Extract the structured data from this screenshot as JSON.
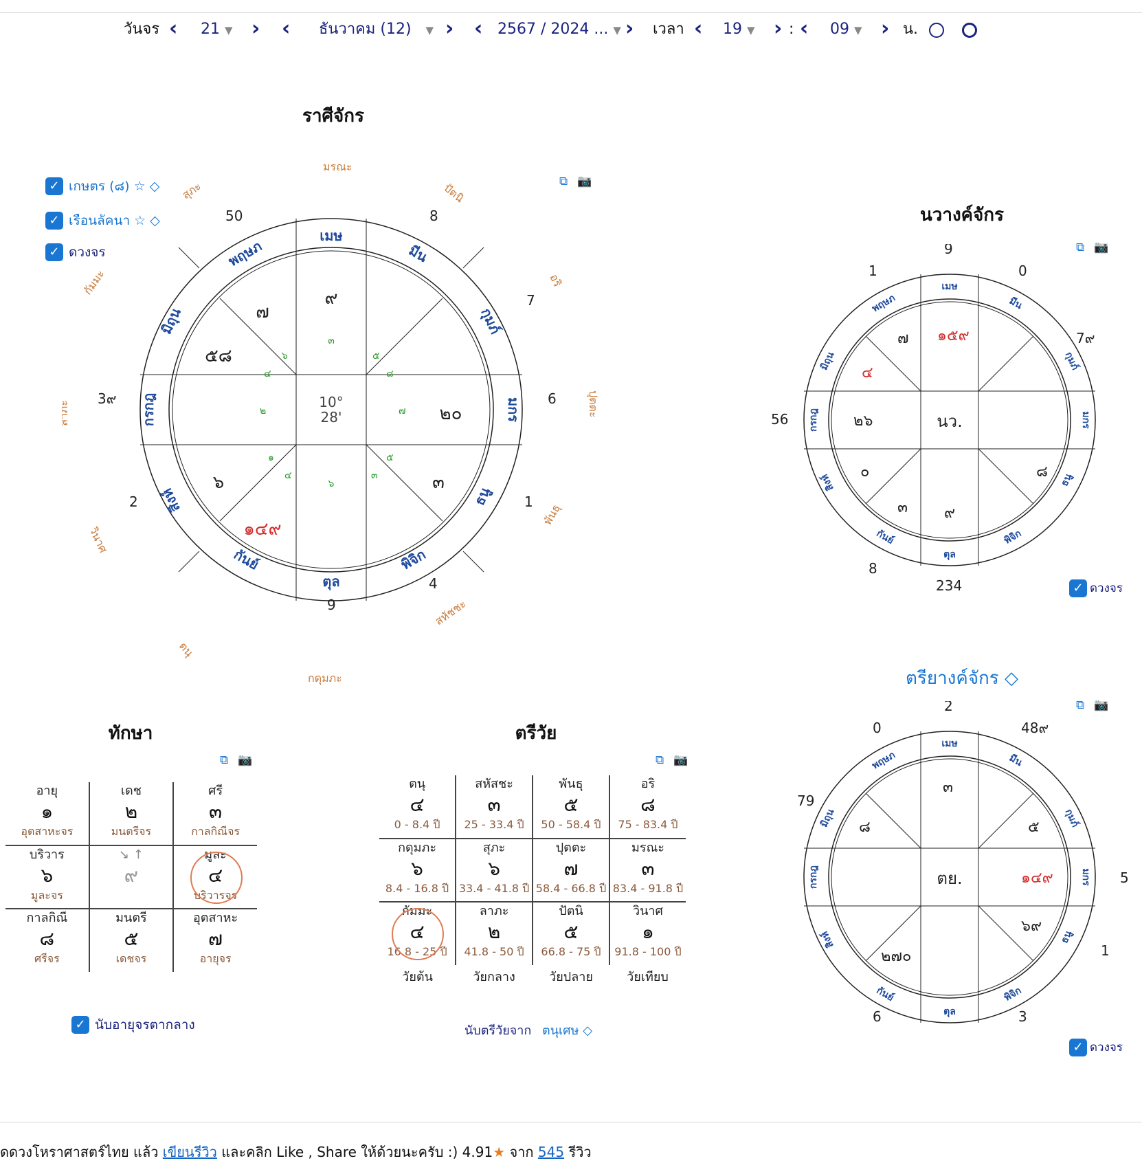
{
  "datebar": {
    "day_label": "วันจร",
    "day_value": "21",
    "month_value": "ธันวาคม (12)",
    "year_value": "2567 / 2024 ...",
    "time_label": "เวลา",
    "hour_value": "19",
    "colon": ":",
    "minute_value": "09",
    "unit": "น."
  },
  "rasi": {
    "title": "ราศีจักร",
    "checkboxes": [
      {
        "label": "เกษตร (๘) ☆ ◇",
        "checked": true
      },
      {
        "label": "เรือนลัคนา ☆ ◇",
        "checked": true
      },
      {
        "label": "ดวงจร",
        "checked": true
      }
    ],
    "center": [
      "10°",
      "28'"
    ],
    "signs": [
      "เมษ",
      "พฤษภ",
      "มิถุน",
      "กรกฎ",
      "สิงห์",
      "กันย์",
      "ตุล",
      "พิจิก",
      "ธนู",
      "มกร",
      "กุมภ์",
      "มีน"
    ],
    "outer_numbers": [
      "50",
      "8",
      "7",
      "6",
      "1",
      "4",
      "9",
      "2",
      "3๙"
    ],
    "house_names": [
      "มรณะ",
      "ปัตนิ",
      "อริ",
      "ปุตตะ",
      "พันธุ",
      "สหัชชะ",
      "กดุมภะ",
      "ตนุ",
      "วินาศ",
      "ลาภะ",
      "กัมมะ",
      "สุภะ"
    ],
    "cell_planets": [
      "๙",
      "๗",
      "๕๘",
      "๖",
      "๑๔๙",
      "๓",
      "๒๐"
    ],
    "small_numbers": [
      "๓",
      "๖",
      "๔",
      "๕",
      "๘",
      "๒",
      "๗",
      "๑",
      "๔",
      "๖",
      "๓",
      "๕"
    ]
  },
  "navang": {
    "title": "นวางค์จักร",
    "center": "นว.",
    "outer_numbers": [
      "9",
      "0",
      "7๙",
      "56",
      "234",
      "1",
      "8"
    ],
    "cell_planets": [
      "๑๕๙",
      "๗",
      "๔",
      "๒๖",
      "๐",
      "๓",
      "๙",
      "๘"
    ],
    "checkbox": "ดวงจร"
  },
  "triyang": {
    "title": "ตรียางค์จักร ◇",
    "center": "ตย.",
    "outer_numbers": [
      "2",
      "0",
      "48๙",
      "79",
      "5",
      "1",
      "3",
      "6"
    ],
    "cell_planets": [
      "๓",
      "๘",
      "๕",
      "๑๔๙",
      "๖๙",
      "๒๗๐"
    ],
    "checkbox": "ดวงจร"
  },
  "taksa": {
    "title": "ทักษา",
    "rows": [
      [
        {
          "n": "อายุ",
          "v": "๑",
          "s": "อุตสาหะจร"
        },
        {
          "n": "เดช",
          "v": "๒",
          "s": "มนตรีจร"
        },
        {
          "n": "ศรี",
          "v": "๓",
          "s": "กาลกิณีจร"
        }
      ],
      [
        {
          "n": "บริวาร",
          "v": "๖",
          "s": "มูละจร"
        },
        {
          "n": "↘ ↑",
          "v": "๙",
          "s": ""
        },
        {
          "n": "มูละ",
          "v": "๔",
          "s": "บริวารจร"
        }
      ],
      [
        {
          "n": "กาลกิณี",
          "v": "๘",
          "s": "ศรีจร"
        },
        {
          "n": "มนตรี",
          "v": "๕",
          "s": "เดชจร"
        },
        {
          "n": "อุตสาหะ",
          "v": "๗",
          "s": "อายุจร"
        }
      ]
    ],
    "checkbox": "นับอายุจรตากลาง"
  },
  "triwai": {
    "title": "ตรีวัย",
    "rows": [
      [
        {
          "n": "ตนุ",
          "v": "๔",
          "s": "0 - 8.4 ปี"
        },
        {
          "n": "สหัสชะ",
          "v": "๓",
          "s": "25 - 33.4 ปี"
        },
        {
          "n": "พันธุ",
          "v": "๕",
          "s": "50 - 58.4 ปี"
        },
        {
          "n": "อริ",
          "v": "๘",
          "s": "75 - 83.4 ปี"
        }
      ],
      [
        {
          "n": "กดุมภะ",
          "v": "๖",
          "s": "8.4 - 16.8 ปี"
        },
        {
          "n": "สุภะ",
          "v": "๖",
          "s": "33.4 - 41.8 ปี"
        },
        {
          "n": "ปุตตะ",
          "v": "๗",
          "s": "58.4 - 66.8 ปี"
        },
        {
          "n": "มรณะ",
          "v": "๓",
          "s": "83.4 - 91.8 ปี"
        }
      ],
      [
        {
          "n": "กัมมะ",
          "v": "๔",
          "s": "16.8 - 25 ปี"
        },
        {
          "n": "ลาภะ",
          "v": "๒",
          "s": "41.8 - 50 ปี"
        },
        {
          "n": "ปัตนิ",
          "v": "๕",
          "s": "66.8 - 75 ปี"
        },
        {
          "n": "วินาศ",
          "v": "๑",
          "s": "91.8 - 100 ปี"
        }
      ]
    ],
    "footer": [
      "วัยต้น",
      "วัยกลาง",
      "วัยปลาย",
      "วัยเทียบ"
    ],
    "count_label": "นับตรีวัยจาก",
    "count_value": "ตนุเศษ ◇"
  },
  "footer": {
    "text1": "ดดวงโหราศาสตร์ไทย แล้ว ",
    "link1": "เขียนรีวิว",
    "text2": " และคลิก Like , Share ให้ด้วยนะครับ :)   4.91",
    "star": "★",
    "text3": " จาก ",
    "link2": "545",
    "text4": " รีวิว"
  },
  "colors": {
    "navy": "#1a237e",
    "brand_blue": "#1976d2",
    "house_orange": "#c77a3a",
    "green": "#2e9a2e",
    "red": "#d32f2f"
  }
}
